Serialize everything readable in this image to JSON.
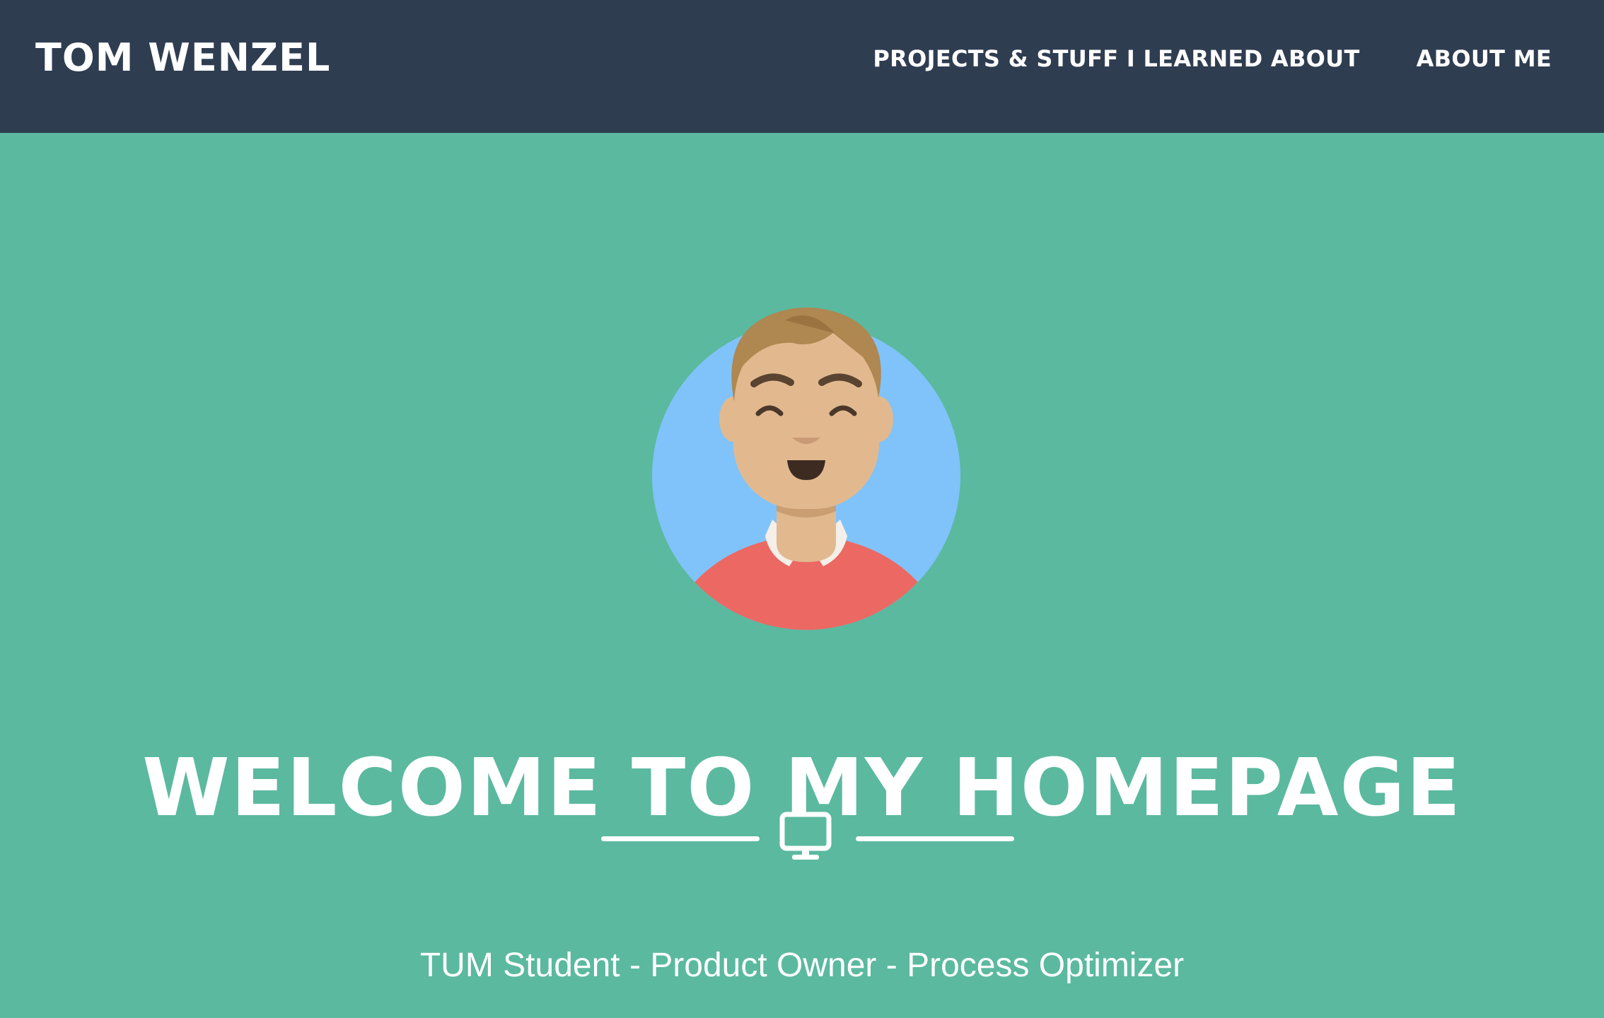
{
  "navbar": {
    "brand": "TOM WENZEL",
    "links": [
      "PROJECTS & STUFF I LEARNED ABOUT",
      "ABOUT ME"
    ],
    "background": "#2f3d51"
  },
  "hero": {
    "avatar_icon": "avatar-illustration",
    "headline": "WELCOME TO MY HOMEPAGE",
    "divider_icon": "monitor-icon",
    "tagline": "TUM Student - Product Owner - Process Optimizer",
    "background": "#5bb99f"
  }
}
